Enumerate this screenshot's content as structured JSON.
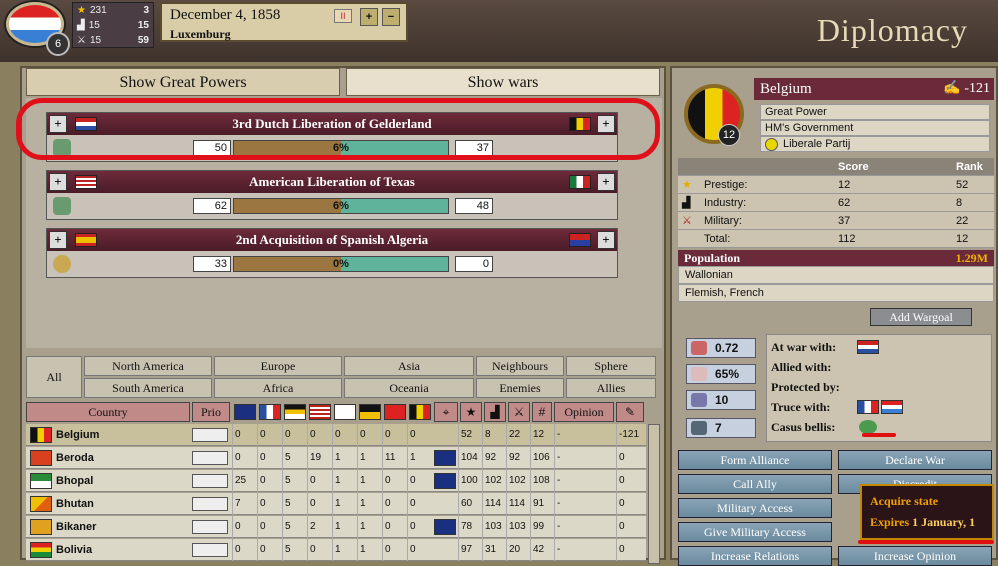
{
  "header": {
    "rank": "6",
    "stats": [
      {
        "icon": "star-icon",
        "a": "231",
        "b": "3"
      },
      {
        "icon": "factory-icon",
        "a": "15",
        "b": "15"
      },
      {
        "icon": "swords-icon",
        "a": "15",
        "b": "59"
      }
    ],
    "date": "December 4, 1858",
    "nation": "Luxemburg",
    "pause_label": "II",
    "speed_plus": "+",
    "speed_minus": "−",
    "title": "Diplomacy"
  },
  "tabs": {
    "great_powers": "Show Great Powers",
    "wars": "Show wars"
  },
  "wars": [
    {
      "name": "3rd Dutch Liberation of Gelderland",
      "left": "50",
      "pct": "6%",
      "right": "37",
      "attacker_flag": "netherlands",
      "defender_flag": "belgium"
    },
    {
      "name": "American Liberation of Texas",
      "left": "62",
      "pct": "6%",
      "right": "48",
      "attacker_flag": "usa",
      "defender_flag": "mexico"
    },
    {
      "name": "2nd  Acquisition of Spanish Algeria",
      "left": "33",
      "pct": "0%",
      "right": "0",
      "attacker_flag": "spain",
      "defender_flag": "algeria"
    }
  ],
  "filters": {
    "all": "All",
    "north_america": "North America",
    "europe": "Europe",
    "asia": "Asia",
    "neighbours": "Neighbours",
    "sphere": "Sphere",
    "south_america": "South America",
    "africa": "Africa",
    "oceania": "Oceania",
    "enemies": "Enemies",
    "allies": "Allies"
  },
  "table": {
    "headers": {
      "country": "Country",
      "prio": "Prio",
      "opinion": "Opinion"
    },
    "rows": [
      {
        "name": "Belgium",
        "cols": [
          "0",
          "0",
          "0",
          "0",
          "0",
          "0",
          "0",
          "0"
        ],
        "gb": false,
        "s": [
          "52",
          "8",
          "22",
          "12"
        ],
        "op": "-",
        "inf": "-121"
      },
      {
        "name": "Beroda",
        "cols": [
          "0",
          "0",
          "5",
          "19",
          "1",
          "1",
          "11",
          "1"
        ],
        "gb": true,
        "s": [
          "104",
          "92",
          "92",
          "106"
        ],
        "op": "-",
        "inf": "0"
      },
      {
        "name": "Bhopal",
        "cols": [
          "25",
          "0",
          "5",
          "0",
          "1",
          "1",
          "0",
          "0"
        ],
        "gb": true,
        "s": [
          "100",
          "102",
          "102",
          "108"
        ],
        "op": "-",
        "inf": "0"
      },
      {
        "name": "Bhutan",
        "cols": [
          "7",
          "0",
          "5",
          "0",
          "1",
          "1",
          "0",
          "0"
        ],
        "gb": false,
        "s": [
          "60",
          "114",
          "114",
          "91"
        ],
        "op": "-",
        "inf": "0"
      },
      {
        "name": "Bikaner",
        "cols": [
          "0",
          "0",
          "5",
          "2",
          "1",
          "1",
          "0",
          "0"
        ],
        "gb": true,
        "s": [
          "78",
          "103",
          "103",
          "99"
        ],
        "op": "-",
        "inf": "0"
      },
      {
        "name": "Bolivia",
        "cols": [
          "0",
          "0",
          "5",
          "0",
          "1",
          "1",
          "0",
          "0"
        ],
        "gb": false,
        "s": [
          "97",
          "31",
          "20",
          "42"
        ],
        "op": "-",
        "inf": "0"
      }
    ]
  },
  "country": {
    "name": "Belgium",
    "infamy": "-121",
    "rank": "12",
    "status": "Great Power",
    "government": "HM's Government",
    "party": "Liberale Partij",
    "score_header": {
      "score": "Score",
      "rank": "Rank"
    },
    "scores": [
      {
        "label": "Prestige:",
        "score": "12",
        "rank": "52"
      },
      {
        "label": "Industry:",
        "score": "62",
        "rank": "8"
      },
      {
        "label": "Military:",
        "score": "37",
        "rank": "22"
      },
      {
        "label": "Total:",
        "score": "112",
        "rank": "12"
      }
    ],
    "population_label": "Population",
    "population": "1.29M",
    "cultures": [
      "Wallonian",
      "Flemish, French"
    ]
  },
  "add_wargoal": "Add Wargoal",
  "rel_stats": [
    "0.72",
    "65%",
    "10",
    "7"
  ],
  "relations": {
    "at_war": "At war with:",
    "allied": "Allied with:",
    "protected": "Protected by:",
    "truce": "Truce with:",
    "casus": "Casus bellis:"
  },
  "actions": {
    "form_alliance": "Form Alliance",
    "declare_war": "Declare War",
    "call_ally": "Call Ally",
    "discredit": "Discredit",
    "military_access": "Military Access",
    "give_military_access": "Give Military Access",
    "increase_relations": "Increase Relations",
    "increase_opinion": "Increase Opinion"
  },
  "tooltip": {
    "line1": "Acquire state",
    "line2_prefix": "Expires",
    "line2_date": "1 January, 1"
  },
  "colors": {
    "accent": "#6a2a3a",
    "annotation": "#e0101a",
    "tooltip_text": "#f0a000"
  }
}
